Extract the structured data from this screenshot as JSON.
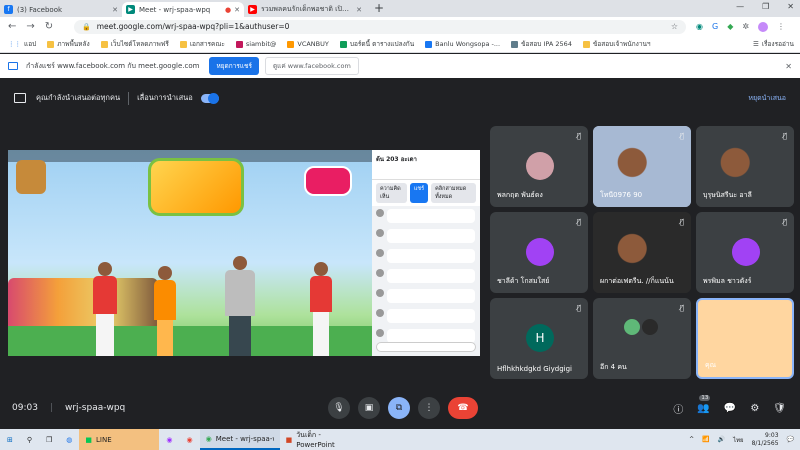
{
  "browser": {
    "tabs": [
      {
        "title": "(3) Facebook",
        "color": "#1877f2",
        "glyph": "f",
        "active": false
      },
      {
        "title": "Meet - wrj-spaa-wpq",
        "color": "#00897b",
        "glyph": "▶",
        "active": true
      },
      {
        "title": "รวมพลคนรักเด็กพอชาติ เปิดโลกนานาขึ้น",
        "color": "#ff0000",
        "glyph": "▶",
        "active": false
      }
    ],
    "new_tab": "+",
    "url": "meet.google.com/wrj-spaa-wpq?pli=1&authuser=0",
    "bookmarks": [
      "แอป",
      "ภาพพื้นหลัง",
      "เว็บไซต์โหลดภาพฟรี",
      "เอกสารคณะ",
      "siambit@",
      "VCANBUY",
      "บอร์ดนี้ ตารางแปลงกัน",
      "Banlu Wongsopa -...",
      "ข้อสอบ IPA 2564",
      "ข้อสอบเจ้าพนักงานฯ"
    ],
    "bookmarks_right": "เรื่องรออ่าน"
  },
  "infobar": {
    "text": "กำลังแชร์ www.facebook.com กับ meet.google.com",
    "stop_label": "หยุดการแชร์",
    "show_label": "ดูแค่ www.facebook.com"
  },
  "presbar": {
    "presenting": "คุณกำลังนำเสนอต่อทุกคน",
    "follow": "เลื่อนการนำเสนอ",
    "stop": "หยุดนำเสนอ"
  },
  "fb": {
    "page_name": "ต้น 203 อะเดา",
    "tabs": [
      "ความคิดเห็น",
      "แชร์",
      "คลิกสามหมดทั้งหมด"
    ],
    "comment_count": 7
  },
  "tiles": [
    {
      "label": "พลกฤต พันธ์ดง",
      "type": "avatar",
      "color": "#d0a0a8",
      "initial": ""
    },
    {
      "label": "โทนี0976 90",
      "type": "photo",
      "color": "#a7b9d3",
      "initial": ""
    },
    {
      "label": "บุรุษนิสรีนะ อาลี",
      "type": "photo",
      "color": "#3c4043",
      "initial": ""
    },
    {
      "label": "ชาลีด้า โกสมใสย์",
      "type": "avatar",
      "color": "#a142f4",
      "initial": ""
    },
    {
      "label": "ผกาต่อเฟตรีน. //ก็แนน้น",
      "type": "photo",
      "color": "#2a2a2a",
      "initial": ""
    },
    {
      "label": "พรพิมล ชาวดังร์",
      "type": "avatar",
      "color": "#a142f4",
      "initial": ""
    },
    {
      "label": "Hflhkhkdgkd Giydgigi",
      "type": "avatar",
      "color": "#00695c",
      "initial": "H"
    },
    {
      "label": "อีก 4 คน",
      "type": "more",
      "color": "#3c4043",
      "initial": ""
    },
    {
      "label": "คุณ",
      "type": "self",
      "color": "#ffd6a0",
      "initial": ""
    }
  ],
  "bottom": {
    "time": "09:03",
    "code": "wrj-spaa-wpq",
    "participants_badge": "13"
  },
  "taskbar": {
    "items": [
      "LINE",
      "Meet - wrj-spaa-wpq...",
      "วันเด็ก - PowerPoint"
    ],
    "lang": "ไทย",
    "time": "9:03",
    "date": "8/1/2565"
  }
}
